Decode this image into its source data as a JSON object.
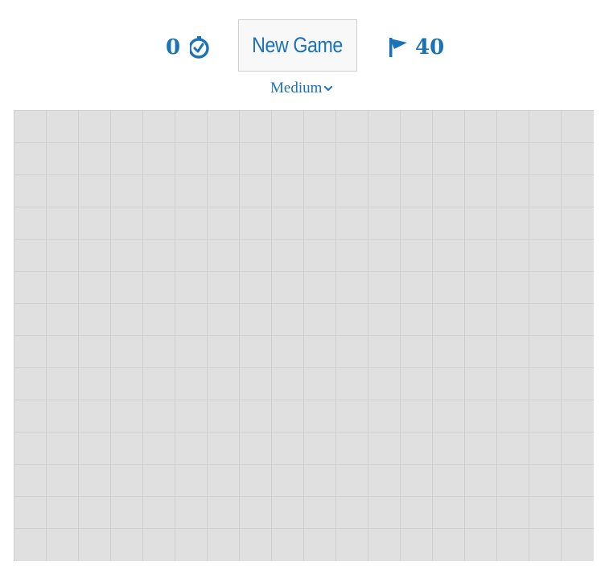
{
  "toolbar": {
    "timer": {
      "value": "0",
      "icon": "stopwatch-icon"
    },
    "new_game_label": "New Game",
    "flags": {
      "value": "40",
      "icon": "flag-icon"
    },
    "difficulty": {
      "selected": "Medium",
      "icon": "chevron-down-icon"
    }
  },
  "board": {
    "columns": 18,
    "rows": 14,
    "cell_state": "unrevealed"
  },
  "colors": {
    "accent": "#1a73b8",
    "cell_fill": "#e0e0e0",
    "grid_line": "#cfcfcf",
    "button_bg": "#f8f8f8"
  }
}
